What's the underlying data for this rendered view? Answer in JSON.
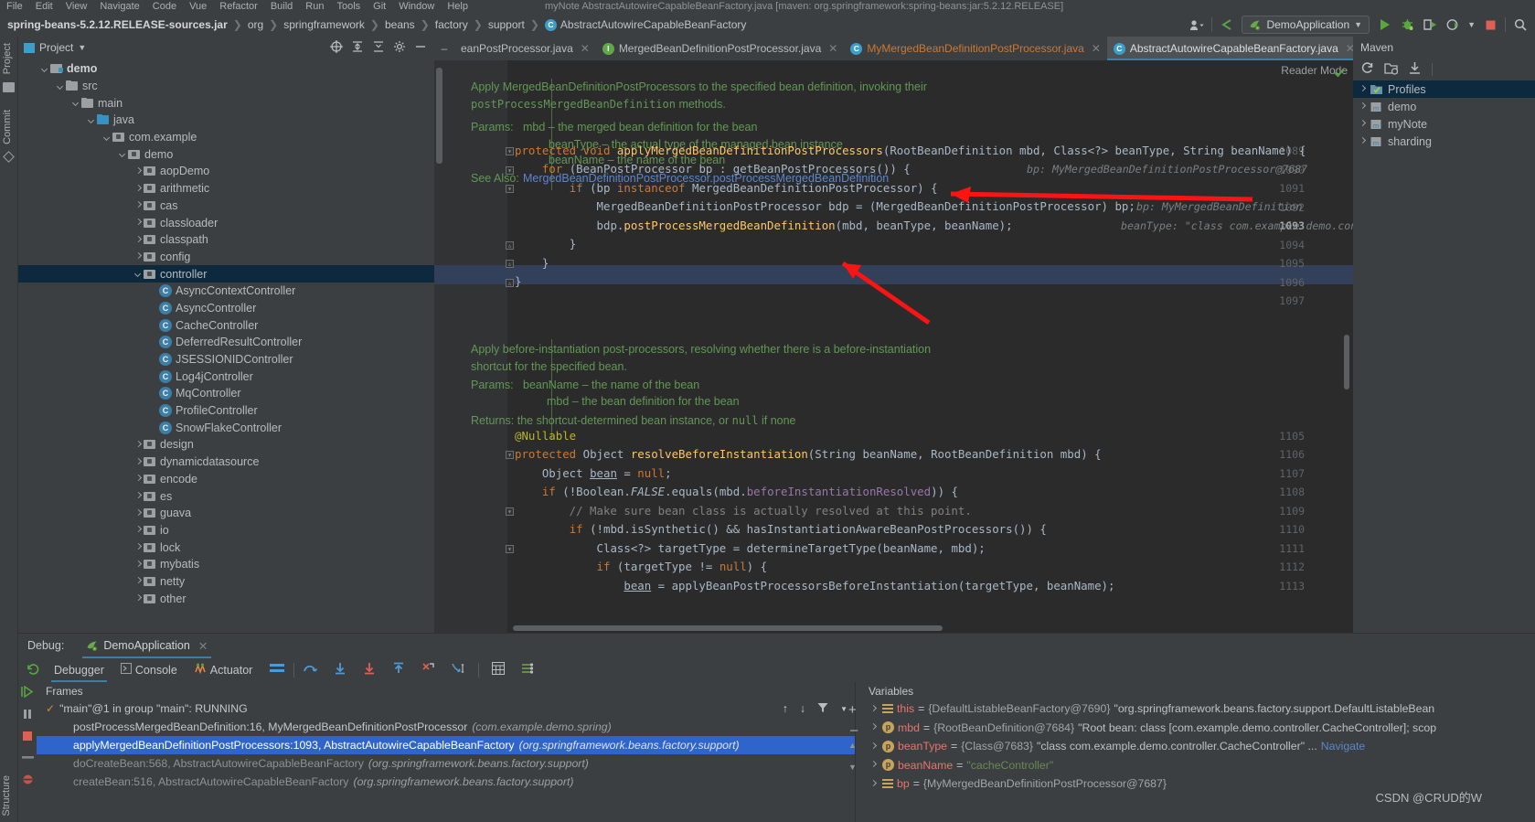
{
  "menu": {
    "items": [
      "File",
      "Edit",
      "View",
      "Navigate",
      "Code",
      "Vue",
      "Refactor",
      "Build",
      "Run",
      "Tools",
      "Git",
      "Window",
      "Help"
    ],
    "tail": "myNote   AbstractAutowireCapableBeanFactory.java [maven: org.springframework:spring-beans:jar:5.2.12.RELEASE]"
  },
  "breadcrumb": {
    "items": [
      "spring-beans-5.2.12.RELEASE-sources.jar",
      "org",
      "springframework",
      "beans",
      "factory",
      "support",
      "AbstractAutowireCapableBeanFactory"
    ],
    "class_badge": "C"
  },
  "toolbar": {
    "run_config": "DemoApplication",
    "icons": [
      "user-icon",
      "back-arrow-icon",
      "run-icon",
      "debug-icon",
      "run-coverage-icon",
      "profile-icon",
      "stop-icon"
    ]
  },
  "left_strip": {
    "tabs": [
      "Project",
      "Commit"
    ],
    "bottom_tab": "Structure"
  },
  "project_panel": {
    "title": "Project",
    "tools": [
      "target-icon",
      "expand-icon",
      "collapse-icon",
      "gear-icon",
      "hide-icon"
    ],
    "tree": [
      {
        "label": "demo",
        "depth": 0,
        "icon": "module",
        "arrow": "down",
        "bold": true
      },
      {
        "label": "src",
        "depth": 1,
        "icon": "folder",
        "arrow": "down"
      },
      {
        "label": "main",
        "depth": 2,
        "icon": "folder",
        "arrow": "down"
      },
      {
        "label": "java",
        "depth": 3,
        "icon": "folder-blue",
        "arrow": "down"
      },
      {
        "label": "com.example",
        "depth": 4,
        "icon": "package",
        "arrow": "down"
      },
      {
        "label": "demo",
        "depth": 5,
        "icon": "package",
        "arrow": "down"
      },
      {
        "label": "aopDemo",
        "depth": 6,
        "icon": "package",
        "arrow": "right"
      },
      {
        "label": "arithmetic",
        "depth": 6,
        "icon": "package",
        "arrow": "right"
      },
      {
        "label": "cas",
        "depth": 6,
        "icon": "package",
        "arrow": "right"
      },
      {
        "label": "classloader",
        "depth": 6,
        "icon": "package",
        "arrow": "right"
      },
      {
        "label": "classpath",
        "depth": 6,
        "icon": "package",
        "arrow": "right"
      },
      {
        "label": "config",
        "depth": 6,
        "icon": "package",
        "arrow": "right"
      },
      {
        "label": "controller",
        "depth": 6,
        "icon": "package",
        "arrow": "down",
        "selected": true
      },
      {
        "label": "AsyncContextController",
        "depth": 7,
        "icon": "class"
      },
      {
        "label": "AsyncController",
        "depth": 7,
        "icon": "class"
      },
      {
        "label": "CacheController",
        "depth": 7,
        "icon": "class"
      },
      {
        "label": "DeferredResultController",
        "depth": 7,
        "icon": "class"
      },
      {
        "label": "JSESSIONIDController",
        "depth": 7,
        "icon": "class"
      },
      {
        "label": "Log4jController",
        "depth": 7,
        "icon": "class"
      },
      {
        "label": "MqController",
        "depth": 7,
        "icon": "class"
      },
      {
        "label": "ProfileController",
        "depth": 7,
        "icon": "class"
      },
      {
        "label": "SnowFlakeController",
        "depth": 7,
        "icon": "class"
      },
      {
        "label": "design",
        "depth": 6,
        "icon": "package",
        "arrow": "right"
      },
      {
        "label": "dynamicdatasource",
        "depth": 6,
        "icon": "package",
        "arrow": "right"
      },
      {
        "label": "encode",
        "depth": 6,
        "icon": "package",
        "arrow": "right"
      },
      {
        "label": "es",
        "depth": 6,
        "icon": "package",
        "arrow": "right"
      },
      {
        "label": "guava",
        "depth": 6,
        "icon": "package",
        "arrow": "right"
      },
      {
        "label": "io",
        "depth": 6,
        "icon": "package",
        "arrow": "right"
      },
      {
        "label": "lock",
        "depth": 6,
        "icon": "package",
        "arrow": "right"
      },
      {
        "label": "mybatis",
        "depth": 6,
        "icon": "package",
        "arrow": "right"
      },
      {
        "label": "netty",
        "depth": 6,
        "icon": "package",
        "arrow": "right"
      },
      {
        "label": "other",
        "depth": 6,
        "icon": "package",
        "arrow": "right"
      }
    ]
  },
  "editor": {
    "tabs": [
      {
        "label": "eanPostProcessor.java",
        "badge": "",
        "badge_color": "",
        "color": "#b9bdc0",
        "active": false,
        "truncated": true
      },
      {
        "label": "MergedBeanDefinitionPostProcessor.java",
        "badge": "I",
        "badge_color": "#62a84a",
        "color": "#b9bdc0",
        "active": false
      },
      {
        "label": "MyMergedBeanDefinitionPostProcessor.java",
        "badge": "C",
        "badge_color": "#3d9ec9",
        "color": "#cc7832",
        "active": false
      },
      {
        "label": "AbstractAutowireCapableBeanFactory.java",
        "badge": "C",
        "badge_color": "#3d9ec9",
        "color": "#d8dbde",
        "active": true
      }
    ],
    "collapse_tab": "chevron-down-icon",
    "reader_mode": "Reader Mode",
    "inspection_status": "ok-check-icon",
    "doc1": {
      "line1": "Apply MergedBeanDefinitionPostProcessors to the specified bean definition, invoking their",
      "line2_mono": "postProcessMergedBeanDefinition",
      "line2_rest": " methods.",
      "params_label": "Params:",
      "params": [
        "mbd – the merged bean definition for the bean",
        "beanType – the actual type of the managed bean instance",
        "beanName – the name of the bean"
      ],
      "seealso_label": "See Also:",
      "seealso_link": "MergedBeanDefinitionPostProcessor.postProcessMergedBeanDefinition"
    },
    "doc2": {
      "line1": "Apply before-instantiation post-processors, resolving whether there is a before-instantiation",
      "line2": "shortcut for the specified bean.",
      "params_label": "Params:",
      "params": [
        "beanName – the name of the bean",
        "mbd – the bean definition for the bean"
      ],
      "returns_label": "Returns:",
      "returns_pre": " the shortcut-determined bean instance, or ",
      "returns_mono": "null",
      "returns_post": " if none"
    },
    "line_numbers": [
      "1089",
      "1090",
      "1091",
      "1092",
      "1093",
      "1094",
      "1095",
      "1096",
      "1097",
      "1105",
      "1106",
      "1107",
      "1108",
      "1109",
      "1110",
      "1111",
      "1112",
      "1113"
    ],
    "current_line": "1093",
    "inline_hints": {
      "line1090": "MyMergedBeanDefinitionPostProcessor@7687",
      "line1090_prefix": "bp:",
      "line1092": "bp: MyMergedBeanDefinition",
      "line1093": "beanType: \"class com.example.demo.controlle",
      "line1089": "b"
    }
  },
  "maven": {
    "title": "Maven",
    "tools": [
      "refresh-icon",
      "add-folder-icon",
      "download-icon"
    ],
    "items": [
      {
        "label": "Profiles",
        "icon": "profiles-folder",
        "selected": true
      },
      {
        "label": "demo",
        "icon": "maven-module"
      },
      {
        "label": "myNote",
        "icon": "maven-module"
      },
      {
        "label": "sharding",
        "icon": "maven-module"
      }
    ]
  },
  "debug": {
    "label": "Debug:",
    "session": "DemoApplication",
    "tabs": [
      {
        "label": "Debugger",
        "active": true,
        "icon": "debugger-icon"
      },
      {
        "label": "Console",
        "active": false,
        "icon": "console-icon"
      },
      {
        "label": "Actuator",
        "active": false,
        "icon": "actuator-icon"
      }
    ],
    "toolbar_icons": [
      "layout-icon",
      "step-over-icon",
      "step-into-icon",
      "force-step-into-icon",
      "step-out-icon",
      "drop-frame-icon",
      "run-to-cursor-icon",
      "evaluate-icon",
      "settings-icon"
    ],
    "left_icons": [
      "rerun-icon",
      "resume-icon",
      "pause-icon",
      "stop-icon",
      "mute-breakpoints-icon",
      "view-breakpoints-icon"
    ],
    "frames": {
      "header": "Frames",
      "thread": "\"main\"@1 in group \"main\": RUNNING",
      "thread_icon": "check-icon",
      "controls": [
        "up-arrow-icon",
        "down-arrow-icon",
        "filter-icon",
        "settings-icon"
      ],
      "rows": [
        {
          "text": "postProcessMergedBeanDefinition:16, MyMergedBeanDefinitionPostProcessor",
          "pkg": "(com.example.demo.spring)",
          "state": "normal"
        },
        {
          "text": "applyMergedBeanDefinitionPostProcessors:1093, AbstractAutowireCapableBeanFactory",
          "pkg": "(org.springframework.beans.factory.support)",
          "state": "selected"
        },
        {
          "text": "doCreateBean:568, AbstractAutowireCapableBeanFactory",
          "pkg": "(org.springframework.beans.factory.support)",
          "state": "dim"
        },
        {
          "text": "createBean:516, AbstractAutowireCapableBeanFactory",
          "pkg": "(org.springframework.beans.factory.support)",
          "state": "dim"
        }
      ]
    },
    "variables": {
      "header": "Variables",
      "controls": [
        "plus-icon",
        "minus-icon",
        "up-icon",
        "down-icon"
      ],
      "rows": [
        {
          "icon": "list",
          "name": "this",
          "ref": "{DefaultListableBeanFactory@7690}",
          "value": "\"org.springframework.beans.factory.support.DefaultListableBean"
        },
        {
          "icon": "param",
          "name": "mbd",
          "ref": "{RootBeanDefinition@7684}",
          "value": "\"Root bean: class [com.example.demo.controller.CacheController]; scop"
        },
        {
          "icon": "param",
          "name": "beanType",
          "ref": "{Class@7683}",
          "value": "\"class com.example.demo.controller.CacheController\" ...",
          "nav": "Navigate"
        },
        {
          "icon": "param",
          "name": "beanName",
          "ref": "",
          "value": "\"cacheController\"",
          "is_string": true
        },
        {
          "icon": "list",
          "name": "bp",
          "ref": "{MyMergedBeanDefinitionPostProcessor@7687}",
          "value": ""
        }
      ]
    }
  },
  "watermark": "CSDN @CRUD的W",
  "colors": {
    "accent": "#3d7ea6",
    "selection": "#2f65ca",
    "tree_selection": "#0d293e",
    "editor_bg": "#2b2b2b",
    "panel_bg": "#3c3f41",
    "arrow_red": "#ff1a1a",
    "keyword": "#cc7832",
    "method": "#ffc66d",
    "string": "#6a8759",
    "field": "#9876aa",
    "comment": "#808080",
    "doc": "#629755"
  }
}
